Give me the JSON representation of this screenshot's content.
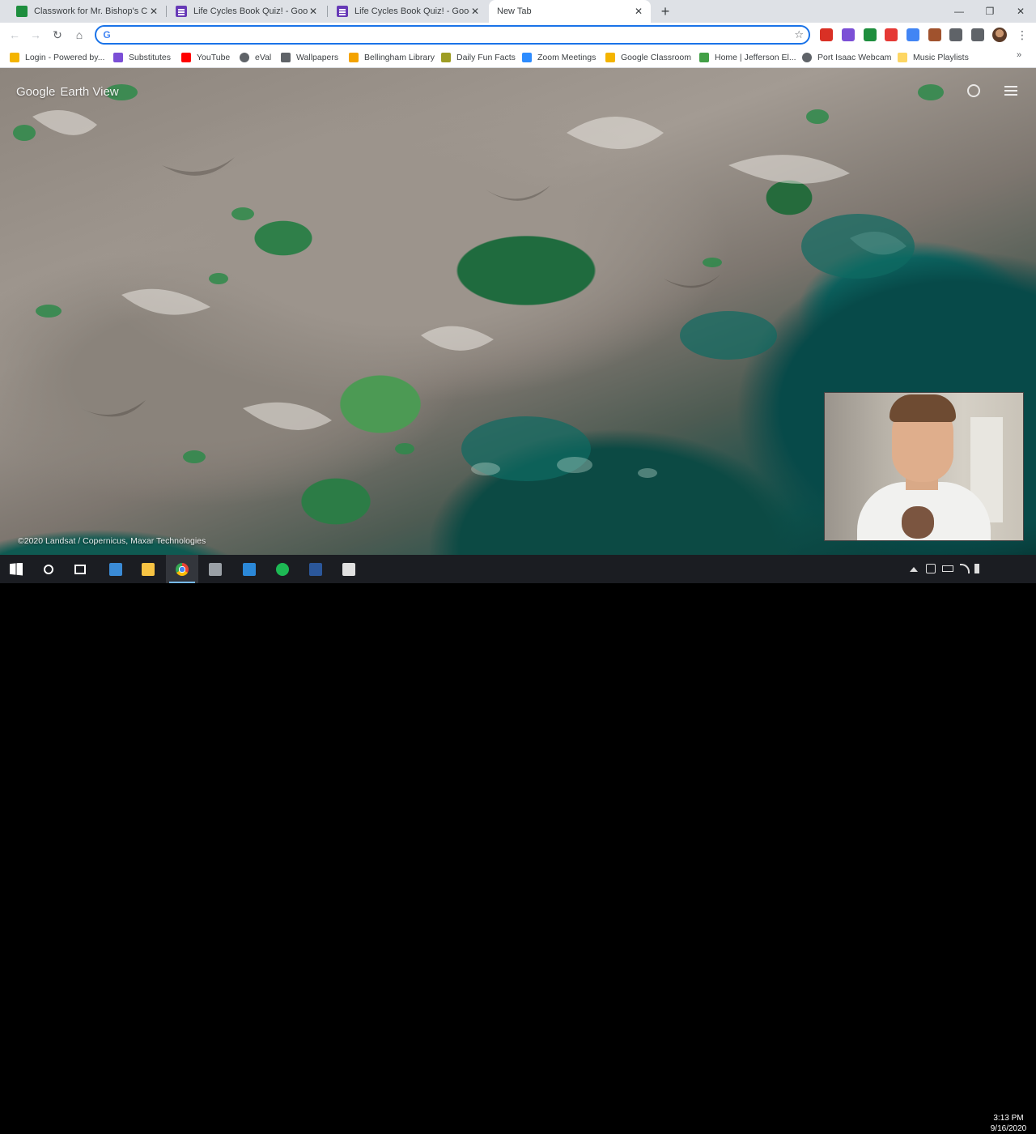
{
  "tabs": [
    {
      "title": "Classwork for Mr. Bishop's Class",
      "icon": "classroom-icon",
      "active": false
    },
    {
      "title": "Life Cycles Book Quiz! - Google F",
      "icon": "forms-icon",
      "active": false
    },
    {
      "title": "Life Cycles Book Quiz! - Google F",
      "icon": "forms-icon",
      "active": false
    },
    {
      "title": "New Tab",
      "icon": "none",
      "active": true
    }
  ],
  "newtab_symbol": "+",
  "window_controls": {
    "minimize": "—",
    "restore": "❐",
    "close": "✕"
  },
  "toolbar": {
    "back": "←",
    "forward": "→",
    "reload": "↻",
    "home": "⌂",
    "omnibox_icon": "G",
    "omnibox_value": "",
    "star": "☆",
    "menu": "⋮"
  },
  "extensions": [
    {
      "name": "gmail-extension-icon",
      "color": "#d93025"
    },
    {
      "name": "purple-extension-icon",
      "color": "#7b4fd6"
    },
    {
      "name": "green-extension-icon",
      "color": "#1e8e3e"
    },
    {
      "name": "red-extension-icon",
      "color": "#e53935"
    },
    {
      "name": "translate-extension-icon",
      "color": "#4285f4"
    },
    {
      "name": "brown-extension-icon",
      "color": "#a0522d"
    },
    {
      "name": "puzzle-extension-icon",
      "color": "#5f6368"
    },
    {
      "name": "media-extension-icon",
      "color": "#5f6368"
    }
  ],
  "bookmarks": [
    {
      "label": "Login - Powered by...",
      "icon": "clever-icon",
      "color": "#f4b400"
    },
    {
      "label": "Substitutes",
      "icon": "substitutes-icon",
      "color": "#7b4fd6"
    },
    {
      "label": "YouTube",
      "icon": "youtube-icon",
      "color": "#ff0000"
    },
    {
      "label": "eVal",
      "icon": "globe-icon",
      "color": "#5f6368"
    },
    {
      "label": "Wallpapers",
      "icon": "wallpapers-icon",
      "color": "#5f6368"
    },
    {
      "label": "Bellingham Library",
      "icon": "library-icon",
      "color": "#f4a300"
    },
    {
      "label": "Daily Fun Facts",
      "icon": "funfacts-icon",
      "color": "#9e9d24"
    },
    {
      "label": "Zoom Meetings",
      "icon": "zoom-icon",
      "color": "#2d8cff"
    },
    {
      "label": "Google Classroom",
      "icon": "classroom-icon",
      "color": "#f4b400"
    },
    {
      "label": "Home | Jefferson El...",
      "icon": "school-icon",
      "color": "#43a047"
    },
    {
      "label": "Port Isaac Webcam",
      "icon": "globe-icon",
      "color": "#5f6368"
    },
    {
      "label": "Music Playlists",
      "icon": "folder-icon",
      "color": "#fdd663"
    }
  ],
  "bookmarks_more": "»",
  "earth_view": {
    "logo_google": "Google",
    "logo_earth_view": "Earth View",
    "attribution": "©2020 Landsat / Copernicus, Maxar Technologies"
  },
  "taskbar": {
    "apps": [
      {
        "name": "windows-start-icon",
        "color": "#ffffff",
        "active": false
      },
      {
        "name": "search-icon",
        "color": "#ffffff",
        "active": false
      },
      {
        "name": "task-view-icon",
        "color": "#ffffff",
        "active": false
      },
      {
        "name": "app-blue-icon",
        "color": "#3a8bd6",
        "active": false
      },
      {
        "name": "file-explorer-icon",
        "color": "#f6c343",
        "active": false
      },
      {
        "name": "chrome-icon",
        "color": "#4285f4",
        "active": true
      },
      {
        "name": "app-gear-icon",
        "color": "#9aa0a6",
        "active": false
      },
      {
        "name": "app-store-icon",
        "color": "#2b88d8",
        "active": false
      },
      {
        "name": "spotify-icon",
        "color": "#1db954",
        "active": false
      },
      {
        "name": "word-icon",
        "color": "#2b579a",
        "active": false
      },
      {
        "name": "photos-icon",
        "color": "#e0e0e0",
        "active": false
      }
    ],
    "time": "3:13 PM",
    "date": "9/16/2020"
  }
}
